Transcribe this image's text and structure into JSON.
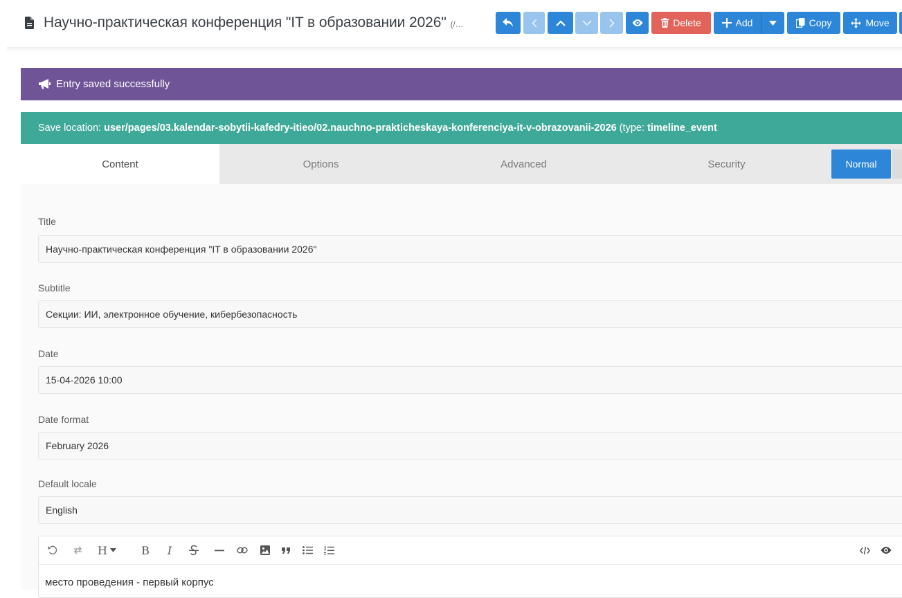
{
  "header": {
    "title": "Научно-практическая конференция \"IT в образовании 2026\"",
    "route": "(/…"
  },
  "toolbar": {
    "delete_label": "Delete",
    "add_label": "Add",
    "copy_label": "Copy",
    "move_label": "Move"
  },
  "messages": {
    "alert": "Entry saved successfully",
    "location_prefix": "Save location: ",
    "location_path": "user/pages/03.kalendar-sobytii-kafedry-itieo/02.nauchno-prakticheskaya-konferenciya-it-v-obrazovanii-2026",
    "location_type_prefix": " (type: ",
    "location_type": "timeline_event"
  },
  "tabs": [
    {
      "label": "Content",
      "active": true
    },
    {
      "label": "Options",
      "active": false
    },
    {
      "label": "Advanced",
      "active": false
    },
    {
      "label": "Security",
      "active": false
    }
  ],
  "mode_button": "Normal",
  "fields": {
    "title": {
      "label": "Title",
      "value": "Научно-практическая конференция \"IT в образовании 2026\""
    },
    "subtitle": {
      "label": "Subtitle",
      "value": "Секции: ИИ, электронное обучение, кибербезопасность"
    },
    "date": {
      "label": "Date",
      "value": "15-04-2026 10:00"
    },
    "date_format": {
      "label": "Date format",
      "value": "February 2026"
    },
    "default_locale": {
      "label": "Default locale",
      "value": "English"
    }
  },
  "editor": {
    "heading_tool": "H",
    "bold_tool": "B",
    "italic_tool": "I",
    "content": "место проведения - первый корпус"
  },
  "colors": {
    "primary": "#2d86d8",
    "danger": "#e1635a",
    "alert_bg": "#6f5598",
    "info_bg": "#3fa999"
  }
}
